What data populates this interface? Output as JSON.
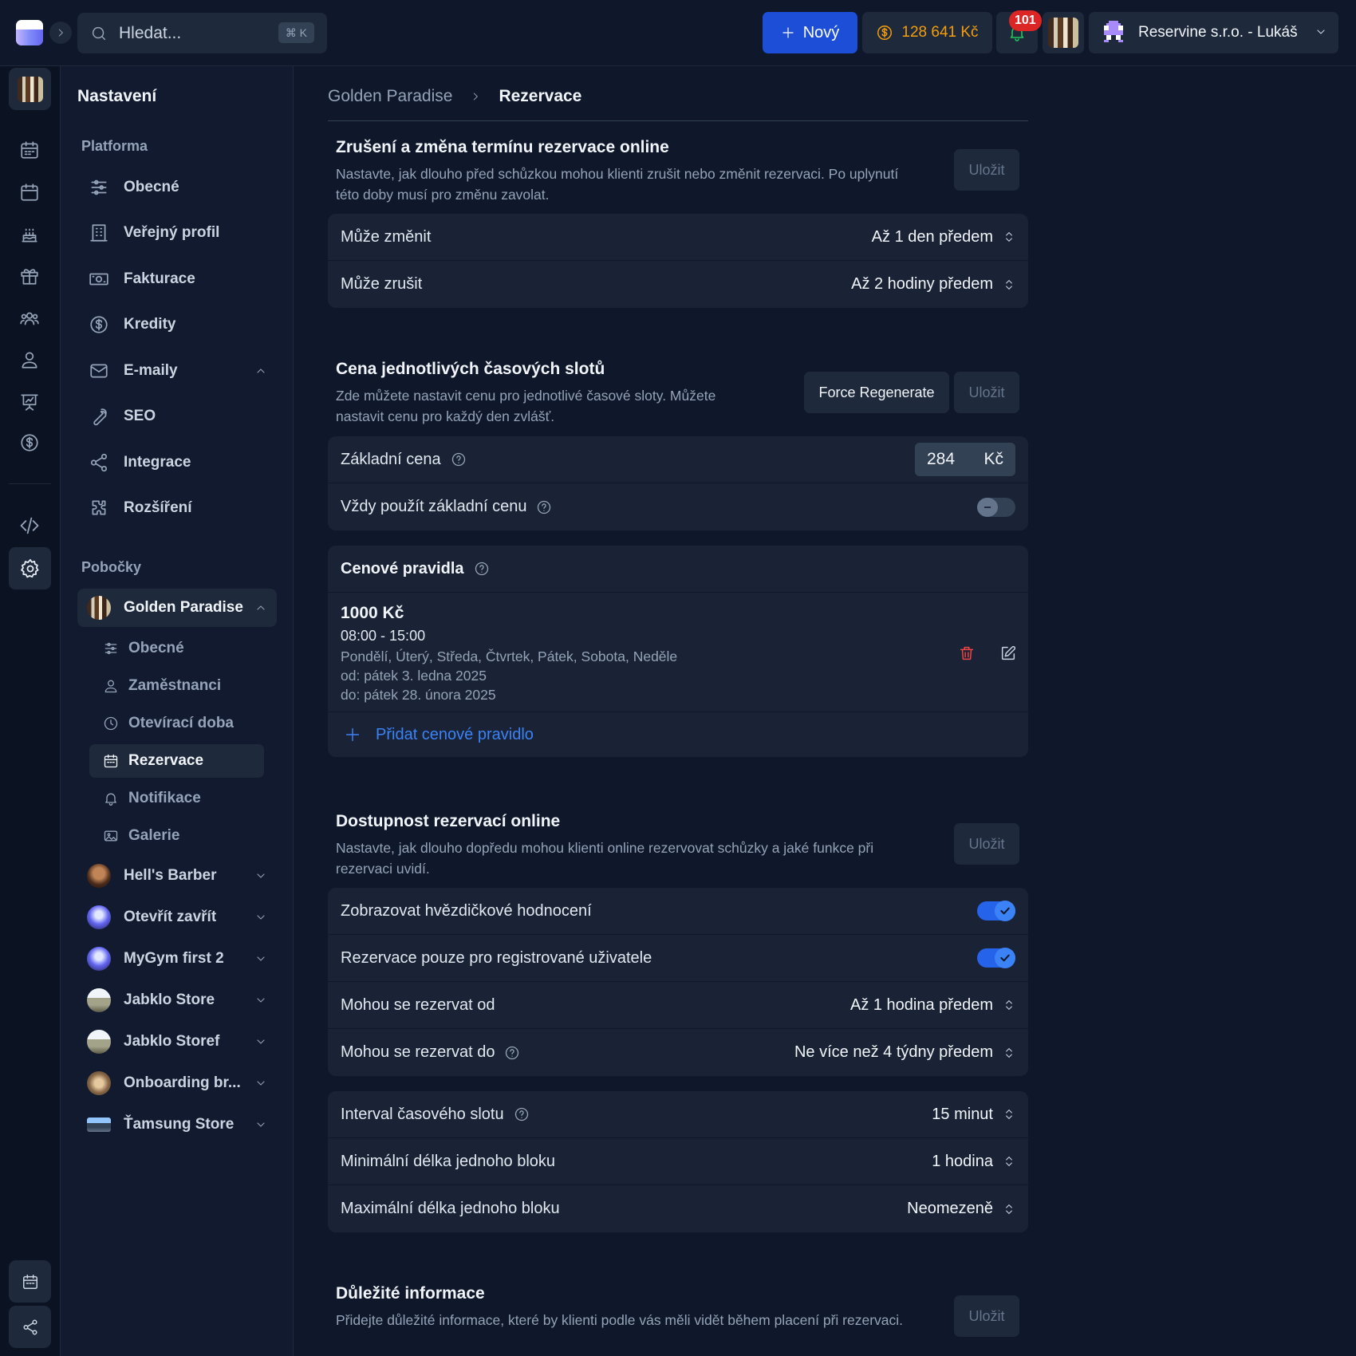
{
  "topbar": {
    "search_placeholder": "Hledat...",
    "search_shortcut": "⌘ K",
    "new_button": "Nový",
    "credits": "128 641 Kč",
    "notifications_count": "101",
    "company": "Reservine s.r.o. - Lukáš"
  },
  "sidebar": {
    "title": "Nastavení",
    "platform_heading": "Platforma",
    "platform_items": [
      {
        "label": "Obecné",
        "icon": "sliders-icon"
      },
      {
        "label": "Veřejný profil",
        "icon": "building-icon"
      },
      {
        "label": "Fakturace",
        "icon": "banknote-icon"
      },
      {
        "label": "Kredity",
        "icon": "dollar-circle-icon"
      },
      {
        "label": "E-maily",
        "icon": "mail-icon"
      },
      {
        "label": "SEO",
        "icon": "wrench-icon"
      },
      {
        "label": "Integrace",
        "icon": "share-icon"
      },
      {
        "label": "Rozšíření",
        "icon": "puzzle-icon"
      }
    ],
    "branches_heading": "Pobočky",
    "active_branch": "Golden Paradise",
    "branch_sub_items": [
      {
        "label": "Obecné",
        "icon": "sliders-icon"
      },
      {
        "label": "Zaměstnanci",
        "icon": "user-icon"
      },
      {
        "label": "Otevírací doba",
        "icon": "clock-icon"
      },
      {
        "label": "Rezervace",
        "icon": "calendar-icon",
        "active": true
      },
      {
        "label": "Notifikace",
        "icon": "bell-icon"
      },
      {
        "label": "Galerie",
        "icon": "image-icon"
      }
    ],
    "other_branches": [
      "Hell's Barber",
      "Otevřít zavřít",
      "MyGym first 2",
      "Jabklo Store",
      "Jabklo Storef",
      "Onboarding br...",
      "Ťamsung Store"
    ]
  },
  "breadcrumb": {
    "parent": "Golden Paradise",
    "current": "Rezervace"
  },
  "cancel_section": {
    "title": "Zrušení a změna termínu rezervace online",
    "description": "Nastavte, jak dlouho před schůzkou mohou klienti zrušit nebo změnit rezervaci. Po uplynutí této doby musí pro změnu zavolat.",
    "save": "Uložit",
    "rows": [
      {
        "label": "Může změnit",
        "value": "Až 1 den předem"
      },
      {
        "label": "Může zrušit",
        "value": "Až 2 hodiny předem"
      }
    ]
  },
  "price_section": {
    "title": "Cena jednotlivých časových slotů",
    "description": "Zde můžete nastavit cenu pro jednotlivé časové sloty. Můžete nastavit cenu pro každý den zvlášť.",
    "regenerate": "Force Regenerate",
    "save": "Uložit",
    "base_price_label": "Základní cena",
    "base_price_value": "284",
    "currency": "Kč",
    "always_base_label": "Vždy použít základní cenu",
    "always_base_on": false
  },
  "price_rules": {
    "title": "Cenové pravidla",
    "rules": [
      {
        "amount": "1000 Kč",
        "time": "08:00 - 15:00",
        "days": "Pondělí, Úterý, Středa, Čtvrtek, Pátek, Sobota, Neděle",
        "from": "od: pátek 3. ledna 2025",
        "to": "do: pátek 28. února 2025"
      }
    ],
    "add_label": "Přidat cenové pravidlo"
  },
  "availability_section": {
    "title": "Dostupnost rezervací online",
    "description": "Nastavte, jak dlouho dopředu mohou klienti online rezervovat schůzky a jaké funkce při rezervaci uvidí.",
    "save": "Uložit",
    "show_rating_label": "Zobrazovat hvězdičkové hodnocení",
    "show_rating_on": true,
    "registered_only_label": "Rezervace pouze pro registrované uživatele",
    "registered_only_on": true,
    "book_from_label": "Mohou se rezervat od",
    "book_from_value": "Až 1 hodina předem",
    "book_to_label": "Mohou se rezervat do",
    "book_to_value": "Ne více než 4 týdny předem"
  },
  "slot_section": {
    "rows": [
      {
        "label": "Interval časového slotu",
        "value": "15 minut"
      },
      {
        "label": "Minimální délka jednoho bloku",
        "value": "1 hodina"
      },
      {
        "label": "Maximální délka jednoho bloku",
        "value": "Neomezeně"
      }
    ]
  },
  "info_section": {
    "title": "Důležité informace",
    "description": "Přidejte důležité informace, které by klienti podle vás měli vidět během placení při rezervaci.",
    "save": "Uložit"
  },
  "colors": {
    "accent": "#1d4ed8",
    "credits": "#f59e0b",
    "badge": "#dc2626",
    "link": "#3b82f6",
    "danger": "#ef4444"
  }
}
